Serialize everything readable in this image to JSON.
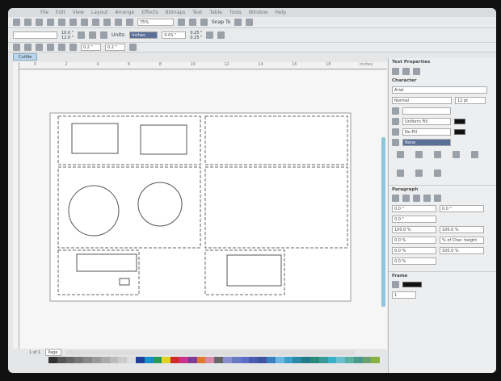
{
  "menu": [
    "File",
    "Edit",
    "View",
    "Layout",
    "Arrange",
    "Effects",
    "Bitmaps",
    "Text",
    "Table",
    "Tools",
    "Window",
    "Help"
  ],
  "toolbar": {
    "zoom": "75%",
    "snap_to": "Snap To"
  },
  "property_bar": {
    "width": "10.0 \"",
    "height": "12.0 \"",
    "units_label": "Units:",
    "units": "inches",
    "nudge": "0.01 \"",
    "dup_x": "0.25 \"",
    "dup_y": "0.25 \""
  },
  "row3": {
    "x": "0.2 \"",
    "y": "0.2 \""
  },
  "document_tab": "Cutfile",
  "ruler_ticks": [
    "0",
    "2",
    "4",
    "6",
    "8",
    "10",
    "12",
    "14",
    "16",
    "18",
    "inches"
  ],
  "status": {
    "page_count": "1 of 1",
    "page_tab": "Page 1"
  },
  "docker": {
    "title": "Text Properties",
    "character": {
      "header": "Character",
      "font": "Arial",
      "style": "Normal",
      "size": "12 pt",
      "fill": "Uniform Fill",
      "bg_fill": "No Fill",
      "outline": "None"
    },
    "paragraph": {
      "header": "Paragraph",
      "indent_left": "0.0 \"",
      "indent_right": "0.0 \"",
      "indent_first": "0.0 \"",
      "line_spacing": "100.0 %",
      "char_spacing": "100.0 %",
      "before": "0.0 %",
      "spacing_unit": "% of Char. height",
      "word": "0.0 %",
      "lang": "100.0 %",
      "after": "0.0 %"
    },
    "frame": {
      "header": "Frame",
      "columns": "1"
    }
  },
  "palette": [
    "#333",
    "#555",
    "#666",
    "#777",
    "#888",
    "#999",
    "#aaa",
    "#bbb",
    "#ccc",
    "#ddd",
    "#1f3f9a",
    "#1b8fc9",
    "#2a9a52",
    "#e3d21f",
    "#d02a2a",
    "#c8338f",
    "#7d3d99",
    "#e07a2a",
    "#d98aa8",
    "#666",
    "#8a8fd0",
    "#6a7ac0",
    "#5c6fc8",
    "#4a5cb0",
    "#3d55a0",
    "#3c7fc0",
    "#6ab8e0",
    "#3aa0c8",
    "#2a8aa8",
    "#227a8a",
    "#2a8a7a",
    "#3a9a9a",
    "#3ab0c8",
    "#6ac0d0",
    "#5ab0a0",
    "#4a9a8a",
    "#6aa070",
    "#8ab040"
  ],
  "colors": {
    "doc_tab": "#b9d6ef",
    "selection": "#5a6f98"
  }
}
